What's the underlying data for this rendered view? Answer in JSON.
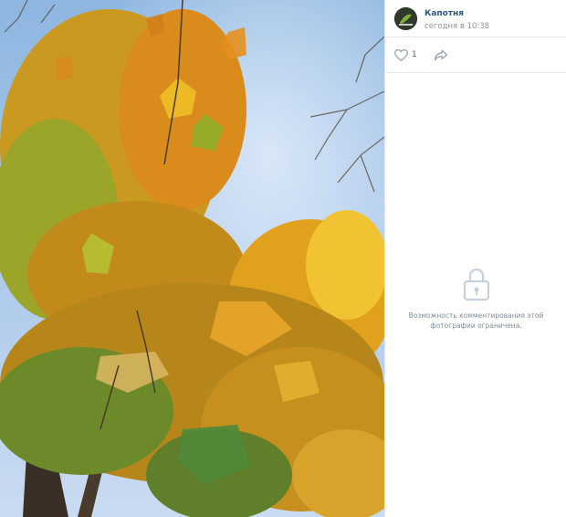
{
  "post": {
    "author": "Капотня",
    "time": "сегодня в 10:38"
  },
  "actions": {
    "like_icon": "heart-icon",
    "like_count": "1",
    "share_icon": "share-arrow-icon"
  },
  "comments": {
    "lock_icon": "lock-icon",
    "disabled_line1": "Возможность комментирования этой",
    "disabled_line2": "фотографии ограничена."
  },
  "colors": {
    "author_link": "#2a5885",
    "muted_text": "#939393",
    "divider": "#e7e8ec",
    "icon_gray": "#99a2ad"
  },
  "photo": {
    "subject": "autumn maple leaves against blue sky"
  }
}
